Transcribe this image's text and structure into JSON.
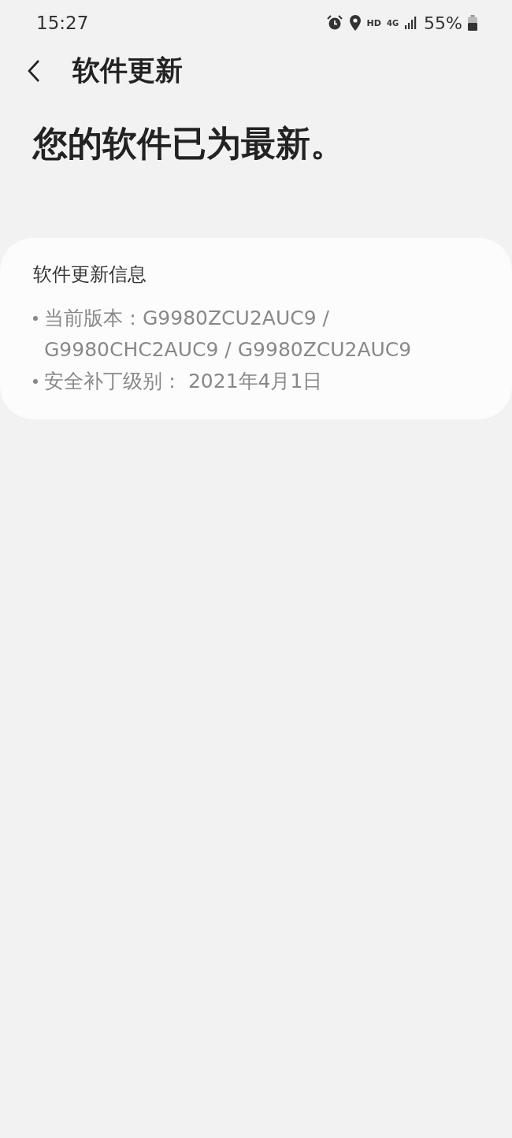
{
  "status_bar": {
    "time": "15:27",
    "network_badge": "HD",
    "network_type": "4G",
    "battery": "55%"
  },
  "header": {
    "title": "软件更新"
  },
  "headline": "您的软件已为最新。",
  "info_card": {
    "title": "软件更新信息",
    "items": [
      {
        "text": "当前版本：G9980ZCU2AUC9 / G9980CHC2AUC9 / G9980ZCU2AUC9"
      },
      {
        "text": "安全补丁级别： 2021年4月1日"
      }
    ]
  }
}
